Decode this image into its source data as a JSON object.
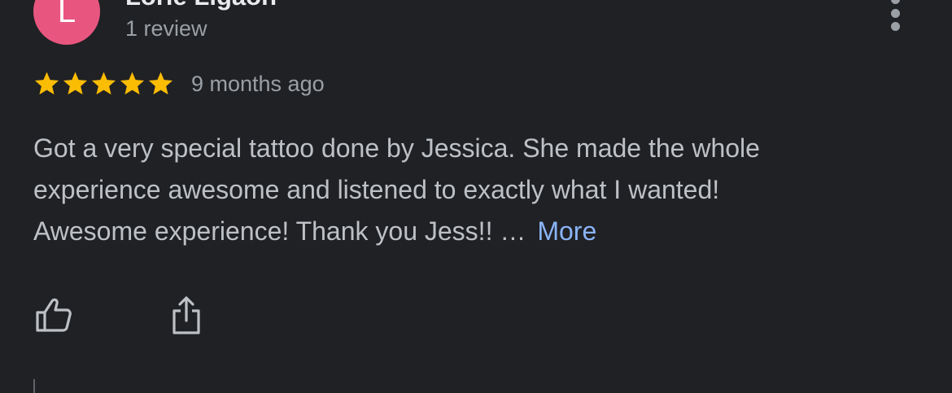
{
  "reviewer": {
    "initial": "L",
    "avatar_color": "#e8567f",
    "name": "Lorie Ligaon",
    "review_count": "1 review"
  },
  "rating": {
    "stars": 5,
    "max_stars": 5,
    "star_color": "#fbbc04",
    "date": "9 months ago"
  },
  "review": {
    "lines": [
      "Got a very special tattoo done by Jessica. She made the whole",
      "experience awesome and listened to exactly what I wanted!",
      "Awesome experience! Thank you Jess!! …"
    ],
    "more_label": "More",
    "link_color": "#8ab4f8"
  },
  "actions": {
    "like_icon": "thumbs-up-icon",
    "share_icon": "share-icon",
    "more_options_icon": "more-vertical-icon"
  }
}
